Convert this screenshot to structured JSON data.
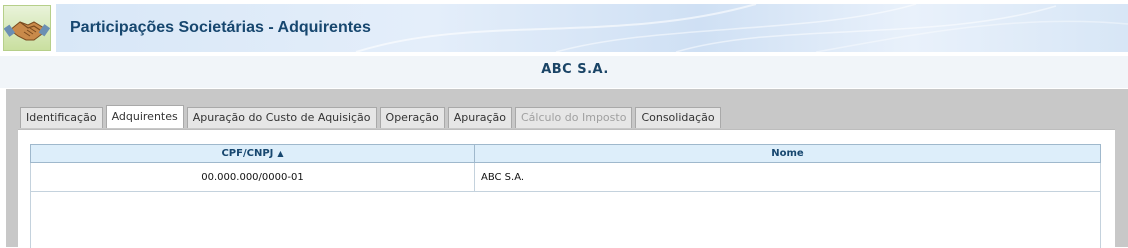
{
  "header": {
    "title": "Participações Societárias - Adquirentes",
    "logo_icon": "handshake-icon"
  },
  "company_name": "ABC S.A.",
  "tabs": [
    {
      "label": "Identificação",
      "state": "normal"
    },
    {
      "label": "Adquirentes",
      "state": "active"
    },
    {
      "label": "Apuração do Custo de Aquisição",
      "state": "normal"
    },
    {
      "label": "Operação",
      "state": "normal"
    },
    {
      "label": "Apuração",
      "state": "normal"
    },
    {
      "label": "Cálculo do Imposto",
      "state": "disabled"
    },
    {
      "label": "Consolidação",
      "state": "normal"
    }
  ],
  "table": {
    "columns": [
      "CPF/CNPJ",
      "Nome"
    ],
    "sort_icon": "sort-ascending-icon",
    "rows": [
      [
        "00.000.000/0000-01",
        "ABC S.A."
      ]
    ]
  },
  "colors": {
    "title": "#17476f",
    "panel": "#c8c8c8",
    "header_cell": "#ddeefa"
  }
}
